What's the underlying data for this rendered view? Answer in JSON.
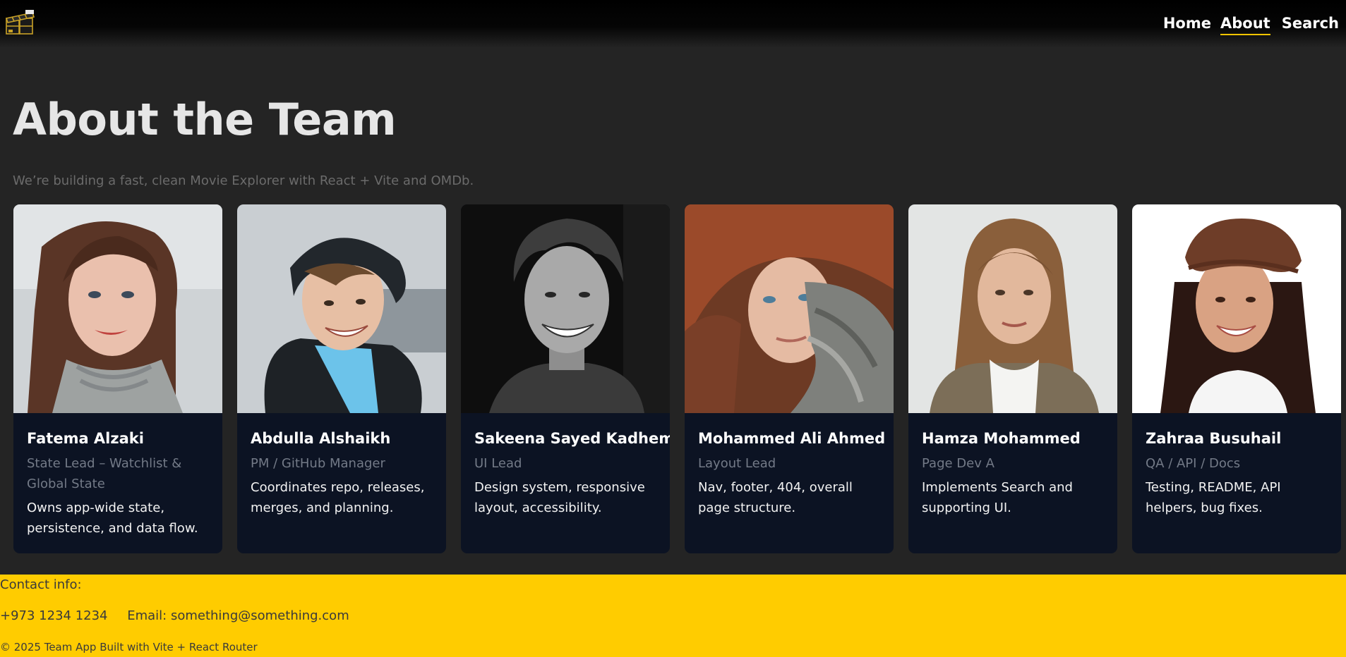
{
  "header": {
    "logo_icon": "film-clapperboard-icon",
    "nav": [
      {
        "label": "Home",
        "active": false
      },
      {
        "label": "About",
        "active": true
      },
      {
        "label": "Search",
        "active": false
      }
    ],
    "accent_color": "#f5c400"
  },
  "main": {
    "title": "About the Team",
    "subtitle": "We’re building a fast, clean Movie Explorer with React + Vite and OMDb.",
    "team": [
      {
        "name": "Fatema Alzaki",
        "role": "State Lead – Watchlist & Global State",
        "desc": "Owns app-wide state, persistence, and data flow."
      },
      {
        "name": "Abdulla Alshaikh",
        "role": "PM / GitHub Manager",
        "desc": "Coordinates repo, releases, merges, and planning."
      },
      {
        "name": "Sakeena Sayed Kadhem",
        "role": "UI Lead",
        "desc": "Design system, responsive layout, accessibility."
      },
      {
        "name": "Mohammed Ali Ahmed",
        "role": "Layout Lead",
        "desc": "Nav, footer, 404, overall page structure."
      },
      {
        "name": "Hamza Mohammed",
        "role": "Page Dev A",
        "desc": "Implements Search and supporting UI."
      },
      {
        "name": "Zahraa Busuhail",
        "role": "QA / API / Docs",
        "desc": "Testing, README, API helpers, bug fixes."
      }
    ]
  },
  "footer": {
    "contact_label": "Contact info:",
    "phone": "+973 1234 1234",
    "email": "Email: something@something.com",
    "copyright": "© 2025 Team App Built with Vite + React Router",
    "background_color": "#ffcc00"
  }
}
